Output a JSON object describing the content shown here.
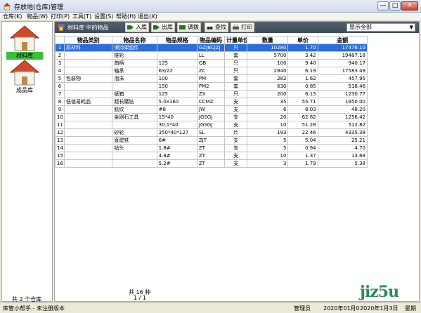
{
  "window": {
    "title": "存放地(仓库)管理",
    "min_glyph": "—",
    "max_glyph": "□",
    "close_glyph": "✕"
  },
  "menu": [
    "仓库(K)",
    "物品(W)",
    "打印(P)",
    "工具(T)",
    "设置(S)",
    "帮助(H)",
    "退出(X)"
  ],
  "left": {
    "stores": [
      {
        "label": "材料库",
        "selected": true
      },
      {
        "label": "成品库",
        "selected": false
      }
    ],
    "count_text": "共 2 个仓库"
  },
  "toolbar": {
    "title": "材料库 中的物品",
    "buttons": [
      {
        "label": "入库",
        "icon": "stock-in-icon"
      },
      {
        "label": "出库",
        "icon": "stock-out-icon"
      },
      {
        "label": "调拨",
        "icon": "transfer-icon"
      },
      {
        "label": "查找",
        "icon": "binoculars-icon"
      },
      {
        "label": "打印",
        "icon": "printer-icon"
      }
    ],
    "filter_value": "显示全部"
  },
  "table": {
    "columns": [
      "",
      "物品类别",
      "物品名称",
      "物品规格",
      "物品编码",
      "计量单位",
      "数量",
      "单价",
      "金额"
    ],
    "rows": [
      [
        "1",
        "原材料",
        "保持架组件",
        "",
        "GZJBCJZJ",
        "只",
        "10280",
        "1.70",
        "17476.10"
      ],
      [
        "2",
        "",
        "链轮",
        "",
        "LL",
        "套",
        "5700",
        "3.42",
        "19487.18"
      ],
      [
        "3",
        "",
        "曲柄",
        "125",
        "QB",
        "只",
        "100",
        "9.40",
        "940.17"
      ],
      [
        "4",
        "",
        "轴承",
        "63/22",
        "ZC",
        "只",
        "2840",
        "6.19",
        "17583.49"
      ],
      [
        "5",
        "包装物",
        "泡沫",
        "100",
        "PM",
        "套",
        "282",
        "1.62",
        "457.95"
      ],
      [
        "6",
        "",
        "",
        "150",
        "PM2",
        "套",
        "630",
        "0.85",
        "538.46"
      ],
      [
        "7",
        "",
        "纸箱",
        "125",
        "ZX",
        "只",
        "200",
        "6.15",
        "1230.77"
      ],
      [
        "8",
        "低值易耗品",
        "超长磨钻",
        "5.0x160",
        "CCMZ",
        "支",
        "35",
        "55.71",
        "1950.00"
      ],
      [
        "9",
        "",
        "肌纹",
        "#8",
        "JW",
        "支",
        "6",
        "8.03",
        "48.20"
      ],
      [
        "10",
        "",
        "金刚石工具",
        "15*40",
        "JGSGJ",
        "支",
        "20",
        "62.82",
        "1256.42"
      ],
      [
        "11",
        "",
        "",
        "30.1*40",
        "JGSGJ",
        "支",
        "10",
        "51.28",
        "512.82"
      ],
      [
        "12",
        "",
        "砂轮",
        "350*40*127",
        "SL",
        "片",
        "193",
        "22.46",
        "4335.38"
      ],
      [
        "13",
        "",
        "直建铁",
        "6#",
        "ZJT",
        "支",
        "5",
        "5.04",
        "25.21"
      ],
      [
        "14",
        "",
        "钻头",
        "1.8#",
        "ZT",
        "支",
        "5",
        "0.94",
        "4.70"
      ],
      [
        "15",
        "",
        "",
        "4.8#",
        "ZT",
        "支",
        "10",
        "1.37",
        "13.68"
      ],
      [
        "16",
        "",
        "",
        "5.2#",
        "ZT",
        "支",
        "3",
        "1.79",
        "5.38"
      ]
    ],
    "footer_count": "共 16 种",
    "footer_page": "1 / 1"
  },
  "status": {
    "left": "库管小帮手 - 未注册版本",
    "role": "管理员",
    "date": "2020年01月0",
    "date2": "2020年1月3日",
    "weekday": "星期"
  },
  "watermark": "jiz5u",
  "colors": {
    "selection": "#2b6fd6",
    "toolbar": "#4a5663",
    "store_selected": "#38c038"
  }
}
